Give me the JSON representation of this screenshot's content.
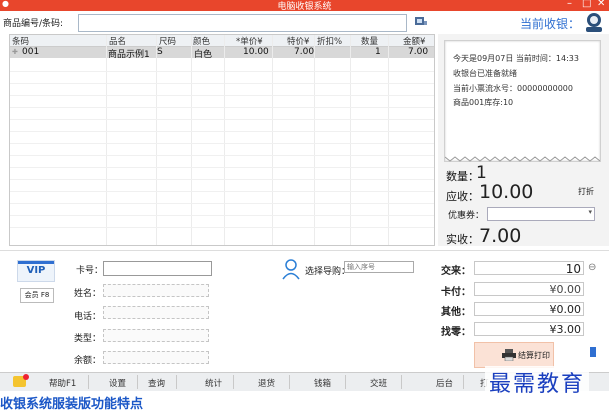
{
  "window": {
    "title": "电脑收银系统",
    "min": "–",
    "max": "□",
    "close": "✕"
  },
  "search": {
    "label": "商品编号/条码:",
    "value": ""
  },
  "cashier": {
    "label": "当前收银："
  },
  "table": {
    "headers": [
      "条码",
      "品名",
      "尺码",
      "颜色",
      "*单价¥",
      "特价¥",
      "折扣%",
      "数量",
      "金额¥"
    ],
    "rows": [
      {
        "marker": "✚",
        "code": "001",
        "name": "商品示例1",
        "size": "S",
        "color": "白色",
        "price": "10.00",
        "special": "7.00",
        "discount": "",
        "qty": "1",
        "amount": "7.00"
      }
    ]
  },
  "receipt": {
    "lines": [
      "今天是09月07日 当前时间：14:33",
      "收银台已准备就绪",
      "当前小票流水号：00000000000",
      "商品001库存:10"
    ]
  },
  "summary": {
    "qty_label": "数量：",
    "qty_value": "1",
    "due_label": "应收：",
    "due_value": "10.00",
    "discount_btn": "打折",
    "coupon_label": "优惠券：",
    "paid_label": "实收：",
    "paid_value": "7.00"
  },
  "member": {
    "vip": "VIP",
    "member_btn": "会员 F8",
    "card_label": "卡号：",
    "name_label": "姓名：",
    "phone_label": "电话：",
    "type_label": "类型：",
    "balance_label": "余额："
  },
  "guide": {
    "label": "选择导购：",
    "placeholder": "输入序号"
  },
  "payment": {
    "cash_label": "交来：",
    "cash_value": "10",
    "card_label": "卡付：",
    "card_value": "¥0.00",
    "other_label": "其他：",
    "other_value": "¥0.00",
    "change_label": "找零：",
    "change_value": "¥3.00",
    "print_btn": "结算打印"
  },
  "toolbar": {
    "items": [
      "帮助F1",
      "设置",
      "查询",
      "统计",
      "退货",
      "钱箱",
      "交班",
      "后台",
      "打"
    ]
  },
  "watermark": "最需教育",
  "caption": "收银系统服装版功能特点",
  "colors": {
    "titlebar": "#e8462c",
    "accent": "#2f6fd1",
    "vip": "#1f5fb8"
  }
}
